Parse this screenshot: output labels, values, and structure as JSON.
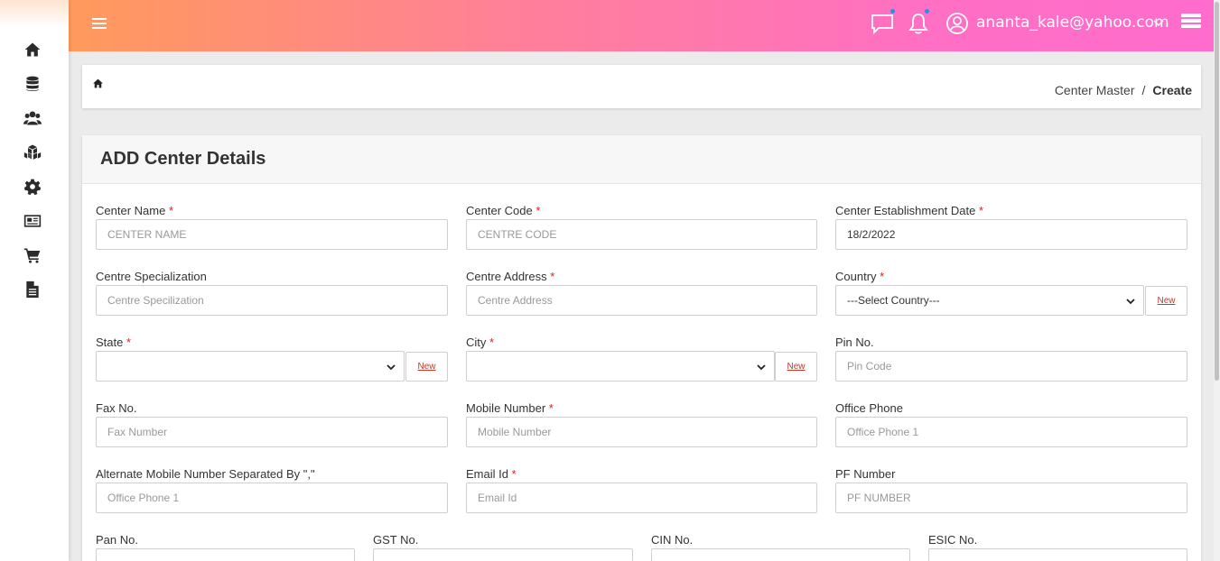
{
  "header": {
    "user_email": "ananta_kale@yahoo.com"
  },
  "breadcrumb": {
    "parent": "Center Master",
    "separator": "/",
    "current": "Create"
  },
  "form": {
    "title": "ADD Center Details",
    "new_label": "New",
    "fields": {
      "center_name": {
        "label": "Center Name",
        "placeholder": "CENTER NAME"
      },
      "center_code": {
        "label": "Center Code",
        "placeholder": "CENTRE CODE"
      },
      "establishment_date": {
        "label": "Center Establishment Date",
        "value": "18/2/2022"
      },
      "specialization": {
        "label": "Centre Specialization",
        "placeholder": "Centre Specilization"
      },
      "address": {
        "label": "Centre Address",
        "placeholder": "Centre Address"
      },
      "country": {
        "label": "Country",
        "selected": "---Select Country---"
      },
      "state": {
        "label": "State",
        "selected": ""
      },
      "city": {
        "label": "City",
        "selected": ""
      },
      "pin": {
        "label": "Pin No.",
        "placeholder": "Pin Code"
      },
      "fax": {
        "label": "Fax No.",
        "placeholder": "Fax Number"
      },
      "mobile": {
        "label": "Mobile Number",
        "placeholder": "Mobile Number"
      },
      "office_phone": {
        "label": "Office Phone",
        "placeholder": "Office Phone 1"
      },
      "alt_mobile": {
        "label": "Alternate Mobile Number Separated By \",\"",
        "placeholder": "Office Phone 1"
      },
      "email": {
        "label": "Email Id",
        "placeholder": "Email Id"
      },
      "pf": {
        "label": "PF Number",
        "placeholder": "PF NUMBER"
      },
      "pan": {
        "label": "Pan No."
      },
      "gst": {
        "label": "GST No."
      },
      "cin": {
        "label": "CIN No."
      },
      "esic": {
        "label": "ESIC No."
      }
    },
    "required_mark": "*"
  },
  "colors": {
    "header_gradient_start": "#ff9a5c",
    "header_gradient_end": "#ff6ccd",
    "required": "#e02020",
    "new_link": "#c0392b"
  },
  "icons": {
    "sidebar": [
      "home-icon",
      "database-icon",
      "users-icon",
      "cubes-icon",
      "gear-icon",
      "newspaper-icon",
      "cart-icon",
      "document-icon"
    ],
    "header": [
      "hamburger-icon",
      "chat-icon",
      "bell-icon",
      "user-circle-icon",
      "chevron-down-icon",
      "menu-grid-icon"
    ]
  }
}
